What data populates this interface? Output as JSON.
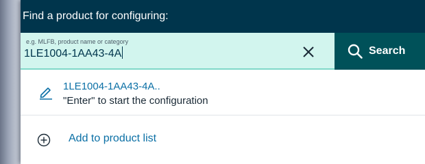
{
  "header": {
    "title": "Find a product for configuring:"
  },
  "search": {
    "placeholder": "e.g. MLFB, product name or category",
    "value": "1LE1004-1AA43-4A",
    "button_label": "Search",
    "clear_icon": "close-icon",
    "search_icon": "magnifier-icon"
  },
  "suggestion": {
    "title": "1LE1004-1AA43-4A..",
    "hint": "\"Enter\" to start the configuration",
    "icon": "pencil-icon"
  },
  "actions": {
    "add_to_list_label": "Add to product list",
    "add_icon": "plus-circle-icon"
  },
  "colors": {
    "header_bg": "#00354c",
    "field_bg": "#d2f5ee",
    "search_button_bg": "#005159",
    "link": "#0a6fa5"
  }
}
